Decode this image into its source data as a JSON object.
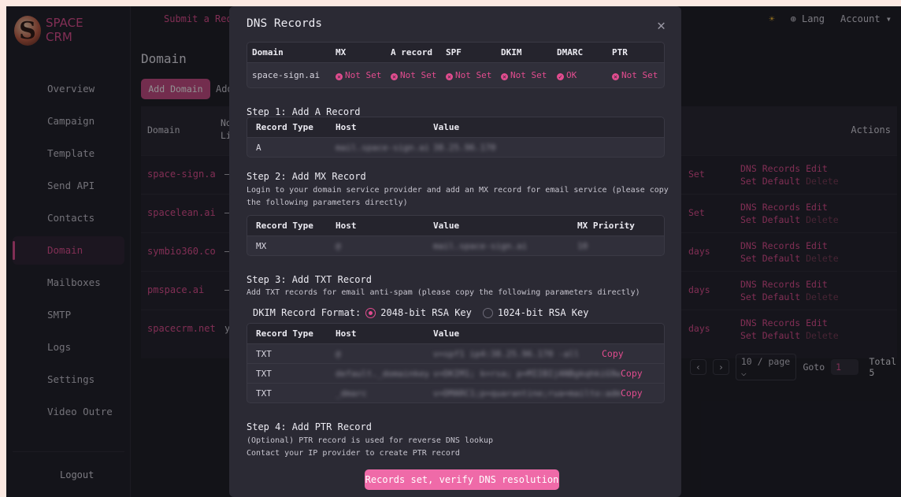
{
  "brand": {
    "line1": "SPACE",
    "line2": "CRM",
    "logo_letter": "S"
  },
  "topbar": {
    "submit": "Submit a Requ",
    "lang": "⊕ Lang",
    "account": "Account ▾",
    "sun": "☀"
  },
  "sidebar": {
    "items": [
      {
        "label": "Overview"
      },
      {
        "label": "Campaign"
      },
      {
        "label": "Template"
      },
      {
        "label": "Send API"
      },
      {
        "label": "Contacts"
      },
      {
        "label": "Domain"
      },
      {
        "label": "Mailboxes"
      },
      {
        "label": "SMTP"
      },
      {
        "label": "Logs"
      },
      {
        "label": "Settings"
      },
      {
        "label": "Video Outre"
      }
    ],
    "logout": "Logout"
  },
  "page": {
    "title": "Domain",
    "add_button": "Add Domain",
    "add_more": "Add",
    "headers": {
      "domain": "Domain",
      "nl1": "No",
      "nl2": "Li",
      "actions": "Actions"
    },
    "rows": [
      {
        "domain": "space-sign.a",
        "dash": "–",
        "status": "Set"
      },
      {
        "domain": "spacelean.ai",
        "dash": "–",
        "status": "Set"
      },
      {
        "domain": "symbio360.co",
        "dash": "–",
        "status": "days"
      },
      {
        "domain": "pmspace.ai",
        "dash": "–",
        "status": "days"
      },
      {
        "domain": "spacecrm.net",
        "dash": "y",
        "status": "days"
      }
    ],
    "row_actions": {
      "dns": "DNS Records",
      "edit": "Edit",
      "default": "Set Default",
      "delete": "Delete"
    },
    "pager": {
      "prev": "‹",
      "next": "›",
      "per_page": "10 / page ⌵",
      "goto": "Goto",
      "page": "1",
      "total": "Total 5"
    }
  },
  "modal": {
    "title": "DNS Records",
    "close": "✕",
    "summary": {
      "headers": [
        "Domain",
        "MX",
        "A record",
        "SPF",
        "DKIM",
        "DMARC",
        "PTR"
      ],
      "row": {
        "domain": "space-sign.ai",
        "mx": "Not Set",
        "a": "Not Set",
        "spf": "Not Set",
        "dkim": "Not Set",
        "dmarc": "OK",
        "ptr": "Not Set"
      }
    },
    "step1": {
      "title": "Step 1: Add A Record",
      "headers": [
        "Record Type",
        "Host",
        "Value"
      ],
      "row": {
        "type": "A",
        "host": "mail.space-sign.ai",
        "value": "38.25.96.170"
      }
    },
    "step2": {
      "title": "Step 2: Add MX Record",
      "desc": "Login to your domain service provider and add an MX record for email service (please copy the following parameters directly)",
      "headers": [
        "Record Type",
        "Host",
        "Value",
        "MX Priority"
      ],
      "row": {
        "type": "MX",
        "host": "@",
        "value": "mail.space-sign.ai",
        "priority": "10"
      }
    },
    "step3": {
      "title": "Step 3: Add TXT Record",
      "desc": "Add TXT records for email anti-spam (please copy the following parameters directly)",
      "dkim_label": "DKIM Record Format:",
      "opt_2048": "2048-bit RSA Key",
      "opt_1024": "1024-bit RSA Key",
      "headers": [
        "Record Type",
        "Host",
        "Value"
      ],
      "rows": [
        {
          "type": "TXT",
          "host": "@",
          "value": "v=spf1 ip4:38.25.96.170 -all",
          "copy": "Copy"
        },
        {
          "type": "TXT",
          "host": "default._domainkey",
          "value": "v=DKIM1; k=rsa; p=MIIBIjANBgkqhkiG9w0B",
          "copy": "Copy"
        },
        {
          "type": "TXT",
          "host": "_dmarc",
          "value": "v=DMARC1;p=quarantine;rua=mailto:admin",
          "copy": "Copy"
        }
      ]
    },
    "step4": {
      "title": "Step 4: Add PTR Record",
      "desc1": "(Optional) PTR record is used for reverse DNS lookup",
      "desc2": "Contact your IP provider to create PTR record"
    },
    "verify_button": "Records set, verify DNS resolution"
  },
  "colors": {
    "accent": "#e24c8f",
    "button": "#ef6aa8",
    "modal_bg": "#2b2a34"
  }
}
